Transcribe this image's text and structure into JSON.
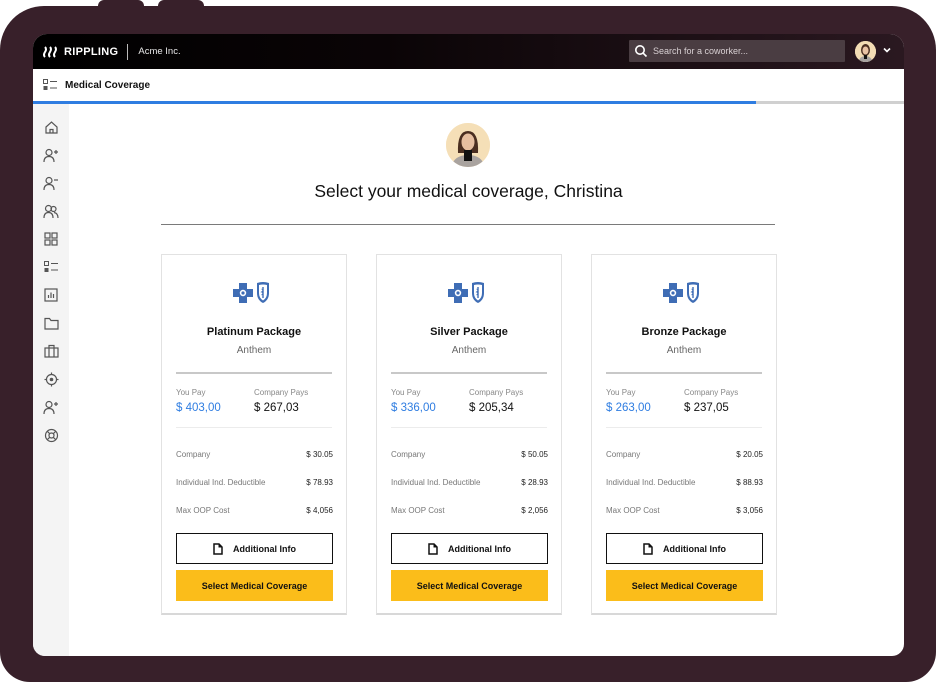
{
  "app": {
    "brand": "RIPPLING",
    "brand_mark": "⌇⌇⌇",
    "company": "Acme Inc."
  },
  "search": {
    "placeholder": "Search for a coworker...",
    "value": ""
  },
  "page": {
    "title": "Medical Coverage",
    "progress_percent": 83
  },
  "sidebar": {
    "items": [
      {
        "icon": "home-icon"
      },
      {
        "icon": "add-person-icon"
      },
      {
        "icon": "remove-person-icon"
      },
      {
        "icon": "people-icon"
      },
      {
        "icon": "apps-grid-icon"
      },
      {
        "icon": "list-icon"
      },
      {
        "icon": "reports-icon"
      },
      {
        "icon": "folder-icon"
      },
      {
        "icon": "briefcase-icon"
      },
      {
        "icon": "settings-icon"
      },
      {
        "icon": "invite-person-icon"
      },
      {
        "icon": "help-lifebuoy-icon"
      }
    ]
  },
  "main": {
    "headline": "Select your medical coverage, Christina",
    "user_name": "Christina"
  },
  "labels": {
    "you_pay": "You Pay",
    "company_pays": "Company Pays",
    "additional_info": "Additional Info",
    "select_coverage": "Select Medical Coverage"
  },
  "plans": [
    {
      "name": "Platinum Package",
      "carrier": "Anthem",
      "you_pay": "$ 403,00",
      "company_pays": "$ 267,03",
      "details": [
        {
          "label": "Company",
          "value": "$ 30.05"
        },
        {
          "label": "Individual Ind. Deductible",
          "value": "$ 78.93"
        },
        {
          "label": "Max OOP Cost",
          "value": "$ 4,056"
        }
      ]
    },
    {
      "name": "Silver Package",
      "carrier": "Anthem",
      "you_pay": "$ 336,00",
      "company_pays": "$ 205,34",
      "details": [
        {
          "label": "Company",
          "value": "$ 50.05"
        },
        {
          "label": "Individual Ind. Deductible",
          "value": "$ 28.93"
        },
        {
          "label": "Max OOP Cost",
          "value": "$ 2,056"
        }
      ]
    },
    {
      "name": "Bronze Package",
      "carrier": "Anthem",
      "you_pay": "$ 263,00",
      "company_pays": "$ 237,05",
      "details": [
        {
          "label": "Company",
          "value": "$ 20.05"
        },
        {
          "label": "Individual Ind. Deductible",
          "value": "$ 88.93"
        },
        {
          "label": "Max OOP Cost",
          "value": "$ 3,056"
        }
      ]
    }
  ],
  "colors": {
    "accent_blue": "#2f7de1",
    "select_button": "#fbbd1a",
    "bezel": "#38202a",
    "carrier_logo": "#3f6db5"
  }
}
